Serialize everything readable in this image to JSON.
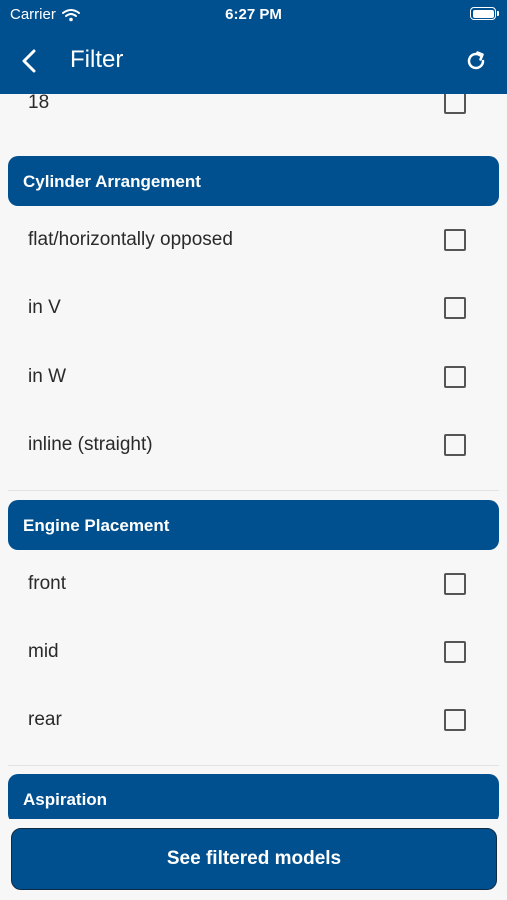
{
  "status_bar": {
    "carrier": "Carrier",
    "time": "6:27 PM"
  },
  "navbar": {
    "title": "Filter",
    "back_icon": "chevron-left-icon",
    "refresh_icon": "refresh-icon"
  },
  "sections": {
    "cylinders_tail": {
      "items": [
        {
          "label": "18",
          "checked": false
        }
      ]
    },
    "cylinder_arrangement": {
      "title": "Cylinder Arrangement",
      "items": [
        {
          "label": "flat/horizontally opposed",
          "checked": false
        },
        {
          "label": "in V",
          "checked": false
        },
        {
          "label": "in W",
          "checked": false
        },
        {
          "label": "inline (straight)",
          "checked": false
        }
      ]
    },
    "engine_placement": {
      "title": "Engine Placement",
      "items": [
        {
          "label": "front",
          "checked": false
        },
        {
          "label": "mid",
          "checked": false
        },
        {
          "label": "rear",
          "checked": false
        }
      ]
    },
    "aspiration": {
      "title": "Aspiration"
    }
  },
  "bottom_button": {
    "label": "See filtered models"
  },
  "colors": {
    "primary": "#00508f",
    "background": "#f7f7f7",
    "text": "#222222"
  }
}
